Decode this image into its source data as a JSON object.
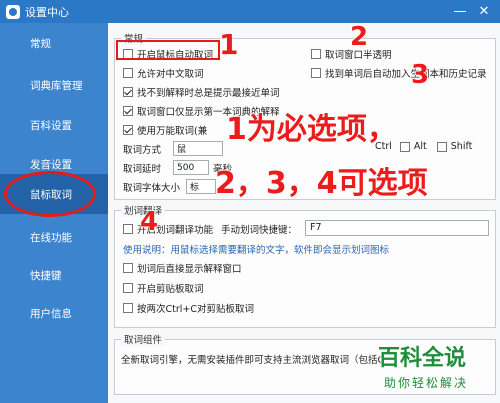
{
  "window": {
    "title": "设置中心",
    "minimize": "—",
    "close": "✕"
  },
  "sidebar": {
    "items": [
      {
        "label": "常规"
      },
      {
        "label": "词典库管理"
      },
      {
        "label": "百科设置"
      },
      {
        "label": "发音设置"
      },
      {
        "label": "鼠标取词"
      },
      {
        "label": "在线功能"
      },
      {
        "label": "快捷键"
      },
      {
        "label": "用户信息"
      }
    ]
  },
  "general": {
    "title": "常规",
    "enable_mouse_lookup": "开启鼠标自动取词",
    "allow_chinese_lookup": "允许对中文取词",
    "show_similar_word": "找不到解释时总是提示最接近单词",
    "show_first_dict_only": "取词窗口仅显示第一本词典的解释",
    "use_universal_lookup": "使用万能取词(兼",
    "window_transparent": "取词窗口半透明",
    "add_to_wordbook": "找到单词后自动加入生词本和历史记录",
    "lookup_method_label": "取词方式",
    "lookup_method_value": "鼠",
    "delay_label": "取词延时",
    "delay_value": "500",
    "delay_unit": "毫秒",
    "font_size_label": "取词字体大小",
    "font_size_value": "标",
    "ctrl": "Ctrl",
    "alt": "Alt",
    "shift": "Shift"
  },
  "translate": {
    "title": "划词翻译",
    "enable": "开启划词翻译功能",
    "shortcut_label": "手动划词快捷键：",
    "shortcut_value": "F7",
    "usage": "使用说明：用鼠标选择需要翻译的文字，软件即会显示划词图标",
    "show_after_select": "划词后直接显示解释窗口",
    "enable_clipboard": "开启剪贴板取词",
    "double_ctrl_c": "按两次Ctrl+C对剪贴板取词"
  },
  "component": {
    "title": "取词组件",
    "desc": "全新取词引擎，无需安装插件即可支持主流浏览器取词（包括C"
  },
  "annotations": {
    "n1": "1",
    "n2": "2",
    "n3": "3",
    "n4": "4",
    "required": "1为必选项，",
    "optional": "2，3，4可选项"
  },
  "watermark": {
    "brand": "百科全说",
    "slogan": "助你轻松解决"
  },
  "colors": {
    "title_bar": "#2b78c6",
    "sidebar": "#3d84ce",
    "sidebar_active": "#2462a8",
    "annotation": "#ea1c1c",
    "watermark": "#1f8e3a"
  }
}
